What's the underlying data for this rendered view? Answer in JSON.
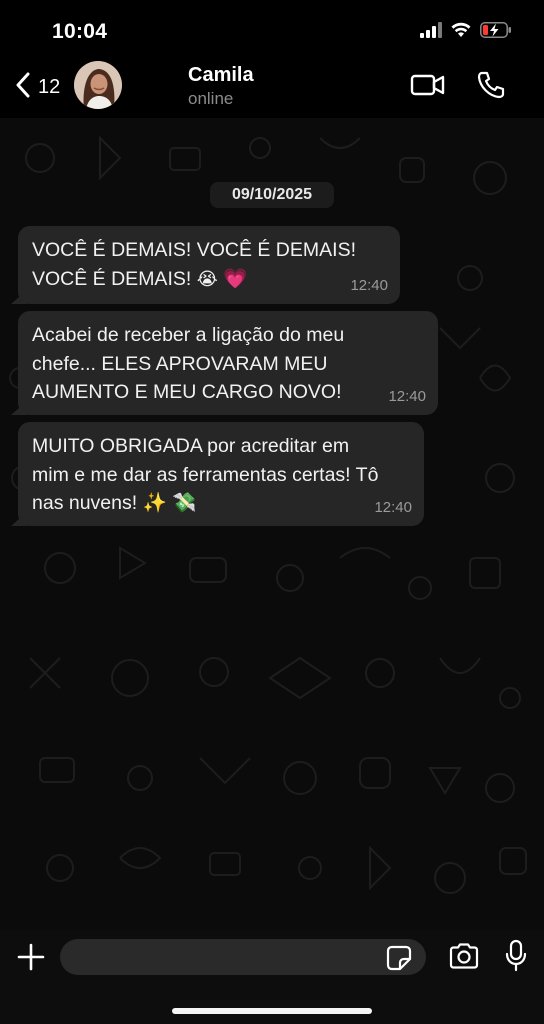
{
  "status_bar": {
    "time": "10:04",
    "icons": [
      "signal-icon",
      "wifi-icon",
      "battery-charging-icon"
    ]
  },
  "header": {
    "back_count": "12",
    "contact_name": "Camila",
    "contact_status": "online",
    "icons": [
      "chevron-left-icon",
      "video-call-icon",
      "phone-icon"
    ]
  },
  "chat": {
    "date": "09/10/2025",
    "messages": [
      {
        "text": "VOCÊ É DEMAIS! VOCÊ É DEMAIS!\nVOCÊ É DEMAIS! 😭 💗",
        "time": "12:40"
      },
      {
        "text": "Acabei de receber a ligação do meu\nchefe... ELES APROVARAM MEU\nAUMENTO E MEU CARGO NOVO!",
        "time": "12:40"
      },
      {
        "text": "MUITO OBRIGADA por acreditar em\nmim e me dar as ferramentas certas! Tô\nnas nuvens! ✨ 💸",
        "time": "12:40"
      }
    ]
  },
  "input_bar": {
    "message_value": "",
    "icons": [
      "plus-icon",
      "sticker-icon",
      "camera-icon",
      "microphone-icon"
    ]
  },
  "colors": {
    "background": "#0b0b0b",
    "bubble": "#262626",
    "battery_accent": "#ff3b30",
    "status_text": "#8c8c8c"
  }
}
